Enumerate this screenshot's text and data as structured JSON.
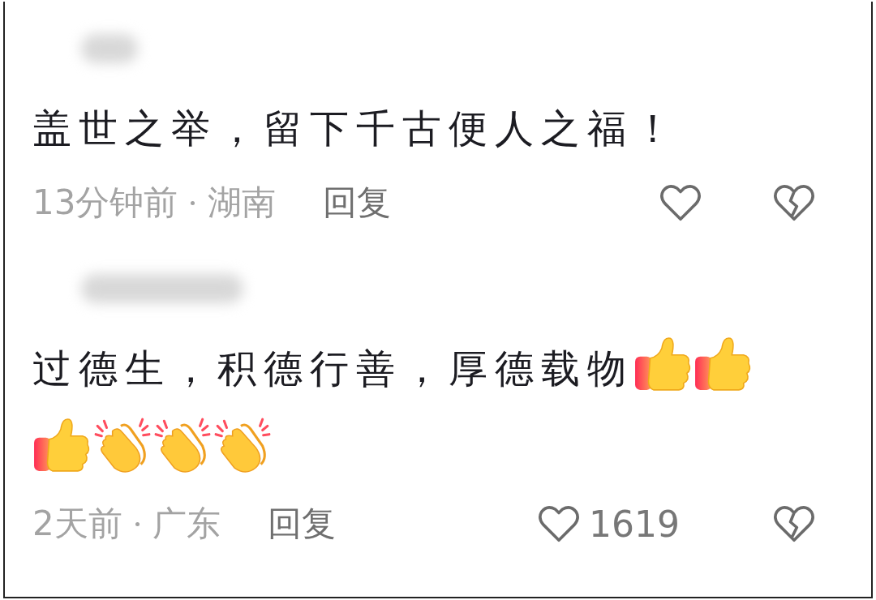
{
  "comments": [
    {
      "text": "盖世之举，留下千古便人之福！",
      "time": "13分钟前",
      "region": "湖南",
      "reply": "回复"
    },
    {
      "text": "过德生，积德行善，厚德载物",
      "emojis": [
        {
          "kind": "thumbs_up"
        },
        {
          "kind": "thumbs_up"
        },
        {
          "kind": "thumbs_up"
        },
        {
          "kind": "clap"
        },
        {
          "kind": "clap"
        },
        {
          "kind": "clap"
        }
      ],
      "time": "2天前",
      "region": "广东",
      "reply": "回复",
      "likes": "1619"
    }
  ]
}
